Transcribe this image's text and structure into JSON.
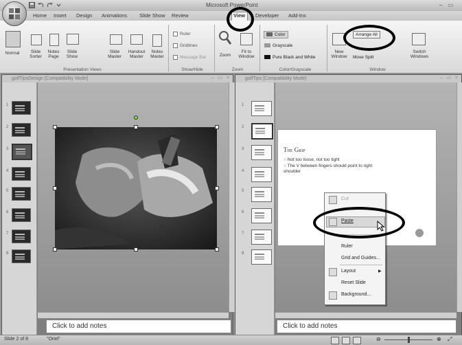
{
  "app": {
    "title": "Microsoft PowerPoint"
  },
  "ribbon": {
    "tabs": [
      "Home",
      "Insert",
      "Design",
      "Animations",
      "Slide Show",
      "Review",
      "View",
      "Developer",
      "Add-Ins"
    ],
    "active_tab": "View",
    "presentation_views": {
      "label": "Presentation Views",
      "buttons": [
        "Normal",
        "Slide Sorter",
        "Notes Page",
        "Slide Show",
        "Slide Master",
        "Handout Master",
        "Notes Master"
      ]
    },
    "show_hide": {
      "label": "Show/Hide",
      "checkboxes": [
        "Ruler",
        "Gridlines",
        "Message Bar"
      ]
    },
    "zoom": {
      "label": "Zoom",
      "buttons": [
        "Zoom",
        "Fit to Window"
      ]
    },
    "color_grayscale": {
      "label": "Color/Grayscale",
      "options": [
        "Color",
        "Grayscale",
        "Pure Black and White"
      ]
    },
    "window": {
      "label": "Window",
      "new_window": "New Window",
      "arrange_all": "Arrange All",
      "move_split": "Move Split",
      "switch_windows": "Switch Windows"
    }
  },
  "left_window": {
    "title": "golfTipsDesign [Compatibility Mode]",
    "thumbnail_numbers": [
      "1",
      "2",
      "3",
      "4",
      "5",
      "6",
      "7",
      "8"
    ],
    "notes_placeholder": "Click to add notes"
  },
  "right_window": {
    "title": "golfTips [Compatibility Mode]",
    "thumbnail_numbers": [
      "1",
      "2",
      "3",
      "4",
      "5",
      "6",
      "7",
      "8"
    ],
    "slide": {
      "title": "The Grip",
      "bullets": [
        "Not too loose, not too tight",
        "The V between fingers should point to right shoulder"
      ]
    },
    "notes_placeholder": "Click to add notes"
  },
  "context_menu": {
    "items": [
      "Cut",
      "Paste",
      "Ruler",
      "Grid and Guides...",
      "Layout",
      "Reset Slide",
      "Background..."
    ]
  },
  "status_bar": {
    "slide_position": "Slide 2 of 8",
    "theme": "\"Oriel\""
  },
  "colors": {
    "highlight_ring": "#000000",
    "ribbon_bg": "#e6e6e6"
  }
}
